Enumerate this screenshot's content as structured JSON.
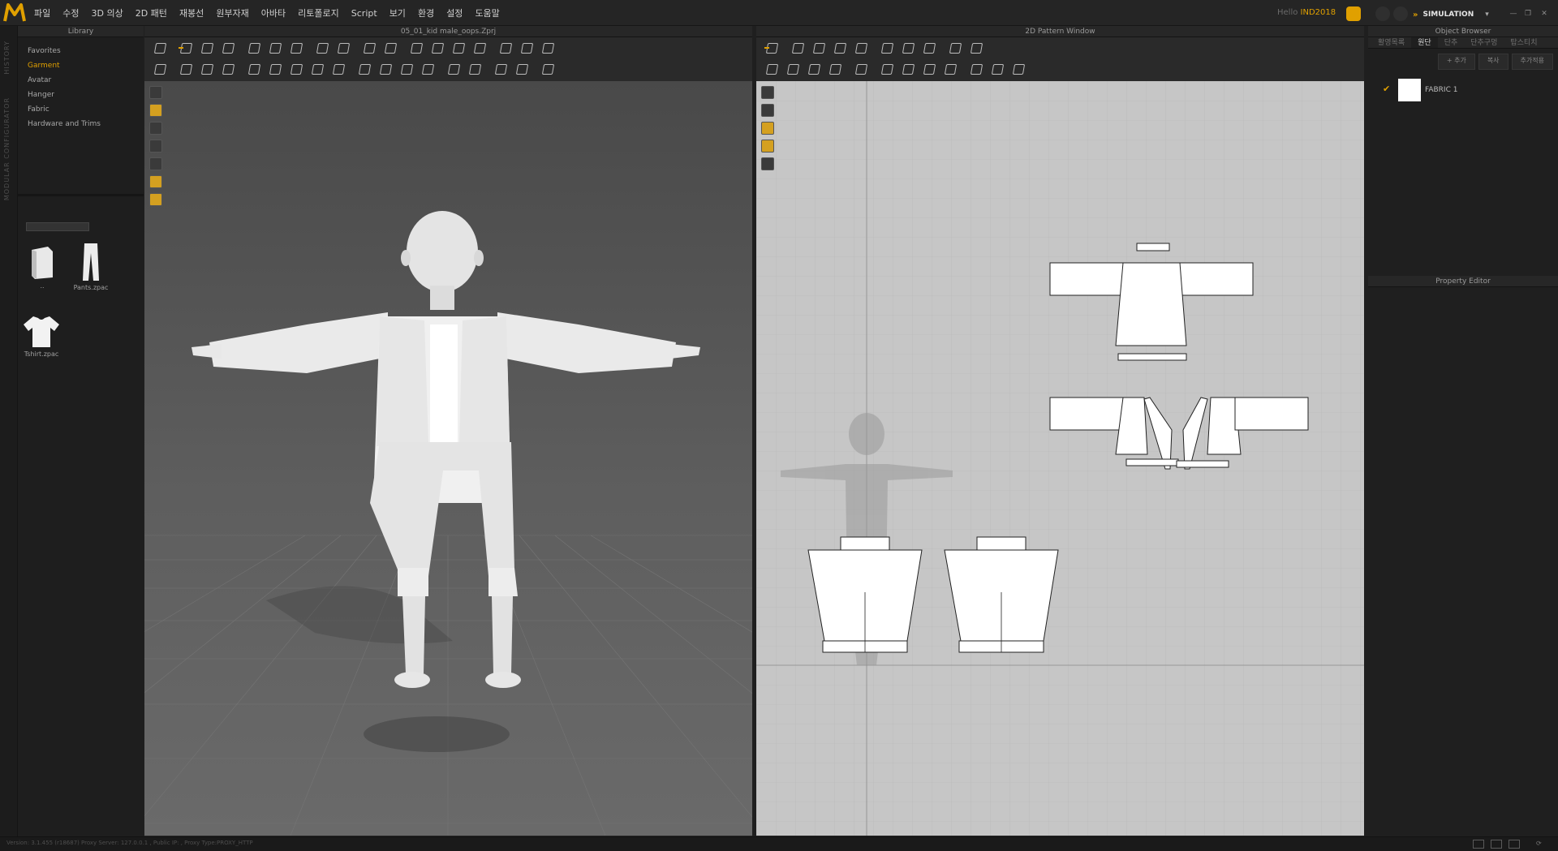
{
  "app": {
    "brand": "MD"
  },
  "menu": [
    "파일",
    "수정",
    "3D 의상",
    "2D 패턴",
    "재봉선",
    "원부자재",
    "아바타",
    "리토폴로지",
    "Script",
    "보기",
    "환경",
    "설정",
    "도움말"
  ],
  "header": {
    "hello": "Hello",
    "user": "IND2018",
    "mode": "SIMULATION"
  },
  "side_strip": {
    "history": "HISTORY",
    "modular": "MODULAR CONFIGURATOR"
  },
  "library": {
    "title": "Library",
    "items": [
      "Favorites",
      "Garment",
      "Avatar",
      "Hanger",
      "Fabric",
      "Hardware and Trims"
    ],
    "active": "Garment",
    "thumbs": [
      "..",
      "Pants.zpac",
      "Tshirt.zpac"
    ]
  },
  "viewport3d": {
    "title": "05_01_kid male_oops.Zprj"
  },
  "viewport2d": {
    "title": "2D Pattern Window"
  },
  "object_browser": {
    "title": "Object Browser",
    "tabs": [
      "활영목록",
      "원단",
      "단추",
      "단추구멍",
      "탑스티치"
    ],
    "selected_tab": "원단",
    "buttons": [
      "+ 추가",
      "복사",
      "추가적용"
    ],
    "fabric_name": "FABRIC 1"
  },
  "property_editor": {
    "title": "Property Editor"
  },
  "status": {
    "version": "Version: 3.1.455 (r18687)",
    "proxy": "Proxy Server: 127.0.0.1 , Public IP:   , Proxy Type:PROXY_HTTP"
  },
  "colors": {
    "accent": "#e0a000",
    "panel": "#1f1f1f",
    "canvas2d": "#c6c6c6"
  }
}
